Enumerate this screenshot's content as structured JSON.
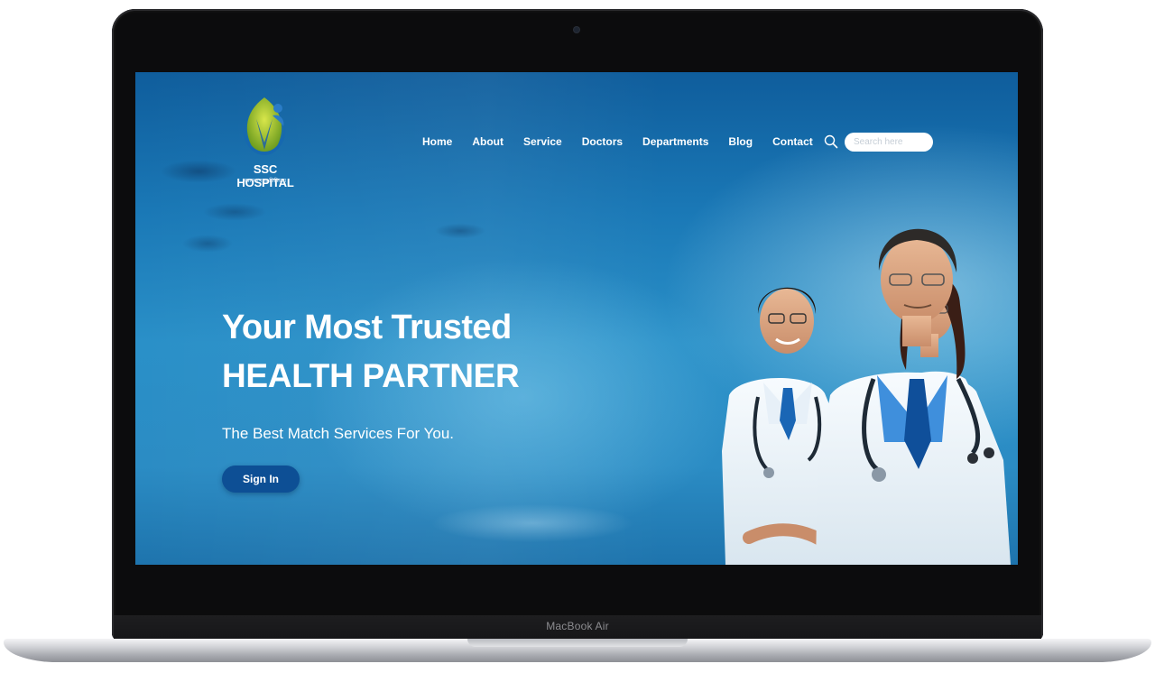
{
  "device": {
    "label": "MacBook Air"
  },
  "logo": {
    "name": "SSC HOSPITAL",
    "tagline": "स्वास्थ्य रक्षा चिकित्सा"
  },
  "nav": {
    "items": [
      {
        "label": "Home"
      },
      {
        "label": "About"
      },
      {
        "label": "Service"
      },
      {
        "label": "Doctors"
      },
      {
        "label": "Departments"
      },
      {
        "label": "Blog"
      },
      {
        "label": "Contact"
      }
    ]
  },
  "search": {
    "placeholder": "Search here",
    "icon": "search-icon"
  },
  "hero": {
    "title_line1": "Your Most Trusted",
    "title_line2": "HEALTH PARTNER",
    "subtitle": "The Best Match Services For You.",
    "cta_label": "Sign In"
  },
  "colors": {
    "accent": "#0d4f95",
    "hero_top": "#0f5d9c",
    "hero_mid": "#2a90c8",
    "text_light": "#ffffff"
  }
}
